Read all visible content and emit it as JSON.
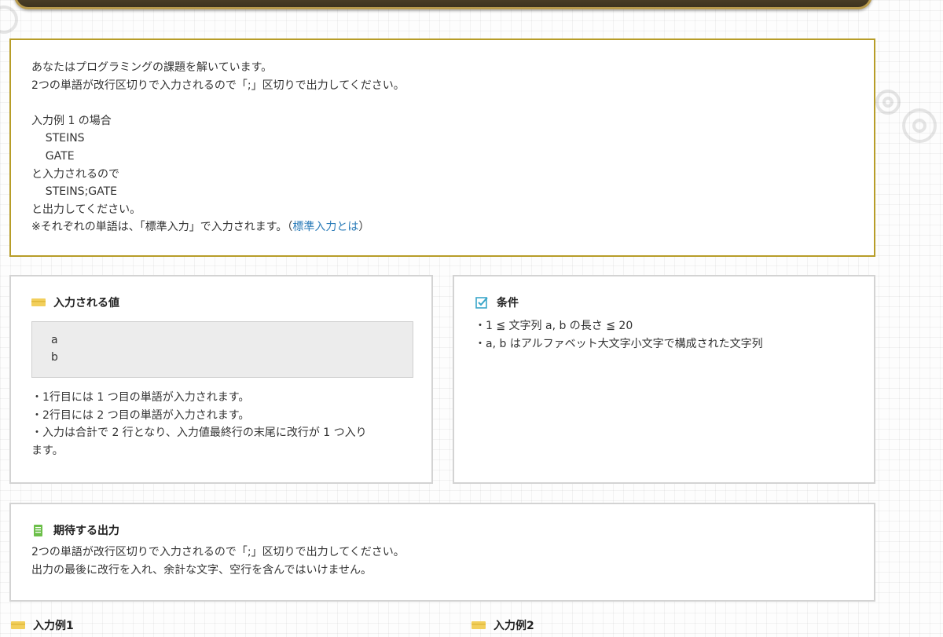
{
  "problem": {
    "lines": [
      "あなたはプログラミングの課題を解いています。",
      "2つの単語が改行区切りで入力されるので「;」区切りで出力してください。",
      "",
      "入力例 1 の場合",
      "    STEINS",
      "    GATE",
      "と入力されるので",
      "    STEINS;GATE",
      "と出力してください。"
    ],
    "last_line_prefix": "※それぞれの単語は、「標準入力」で入力されます。（",
    "last_line_link": "標準入力とは",
    "last_line_suffix": "）"
  },
  "input_section": {
    "title": "入力される値",
    "code_lines": [
      "a",
      "b"
    ],
    "notes": [
      "・1行目には 1 つ目の単語が入力されます。",
      "・2行目には 2 つ目の単語が入力されます。",
      "・入力は合計で 2 行となり、入力値最終行の末尾に改行が 1 つ入り",
      "ます。"
    ]
  },
  "conditions": {
    "title": "条件",
    "items": [
      "・1 ≦ 文字列 a, b の長さ ≦ 20",
      "・a, b はアルファベット大文字小文字で構成された文字列"
    ]
  },
  "expected_output": {
    "title": "期待する出力",
    "lines": [
      "2つの単語が改行区切りで入力されるので「;」区切りで出力してください。",
      "出力の最後に改行を入れ、余計な文字、空行を含んではいけません。"
    ]
  },
  "examples": {
    "example1_title": "入力例1",
    "example2_title": "入力例2"
  },
  "colors": {
    "problem_border": "#b79d28",
    "link": "#2a7bb8",
    "card_border": "#d3d3d3",
    "code_bg": "#ececec",
    "input_icon": "#f2cf5c",
    "cond_icon": "#3aa6c9",
    "output_icon": "#6cbf4a"
  },
  "icons": {
    "input": "yellow-tag-icon",
    "conditions": "checkbox-icon",
    "output": "document-icon",
    "example": "yellow-tag-icon"
  }
}
